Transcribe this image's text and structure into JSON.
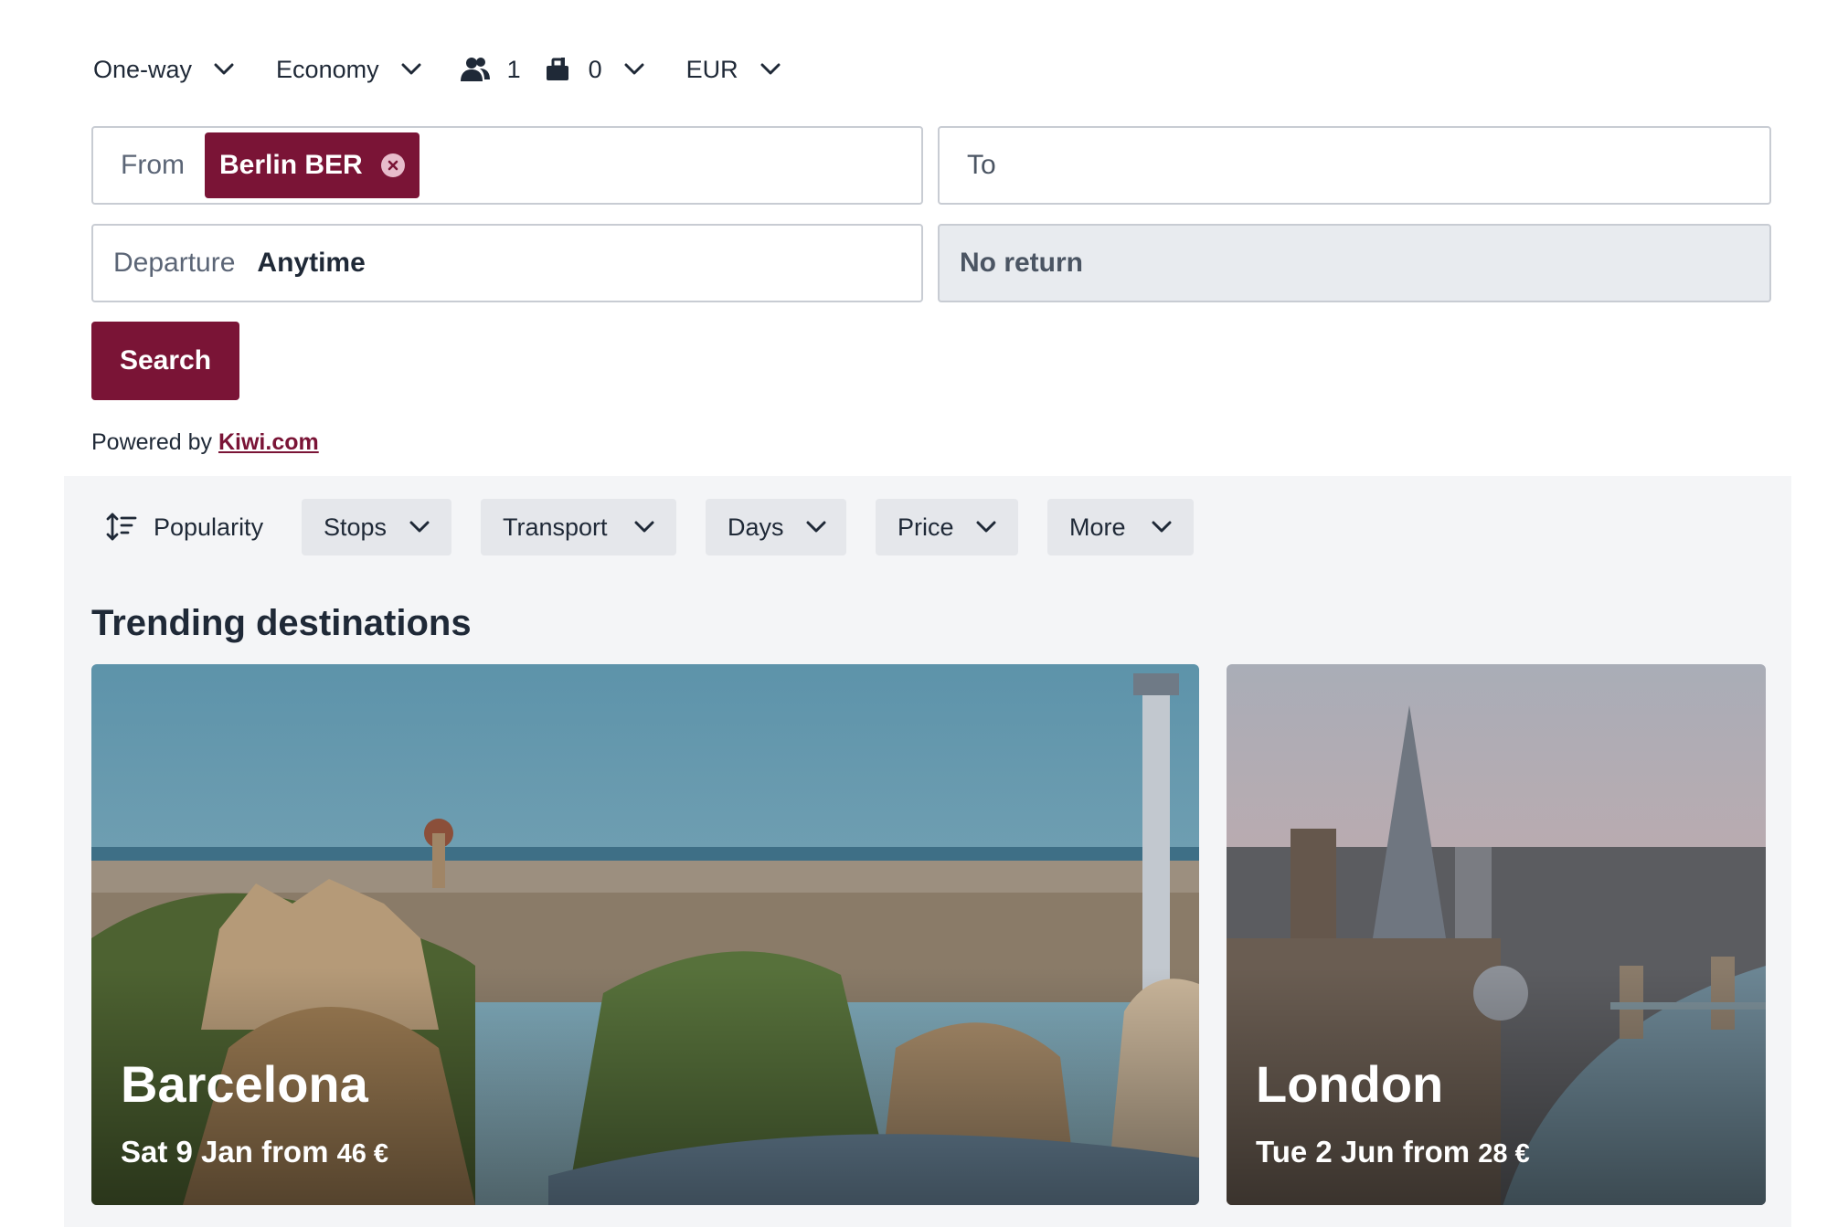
{
  "search_options": {
    "trip_type": "One-way",
    "cabin_class": "Economy",
    "passengers": "1",
    "bags": "0",
    "currency": "EUR"
  },
  "form": {
    "from_label": "From",
    "from_chip": "Berlin BER",
    "to_label": "To",
    "departure_label": "Departure",
    "departure_value": "Anytime",
    "return_label": "No return",
    "search_button": "Search"
  },
  "powered": {
    "prefix": "Powered by",
    "link": "Kiwi.com"
  },
  "filters": {
    "sort_label": "Popularity",
    "stops": "Stops",
    "transport": "Transport",
    "days": "Days",
    "price": "Price",
    "more": "More"
  },
  "trending": {
    "title": "Trending destinations",
    "cards": [
      {
        "city": "Barcelona",
        "date": "Sat 9 Jan",
        "from_word": "from",
        "price": "46 €"
      },
      {
        "city": "London",
        "date": "Tue 2 Jun",
        "from_word": "from",
        "price": "28 €"
      }
    ]
  },
  "colors": {
    "brand": "#7a1436",
    "field_border": "#c8ccd3",
    "panel_bg": "#f4f5f7",
    "filter_button_bg": "#e5e7eb"
  },
  "icons": [
    "chevron-down-icon",
    "passengers-icon",
    "bag-icon",
    "clear-icon",
    "sort-icon"
  ]
}
